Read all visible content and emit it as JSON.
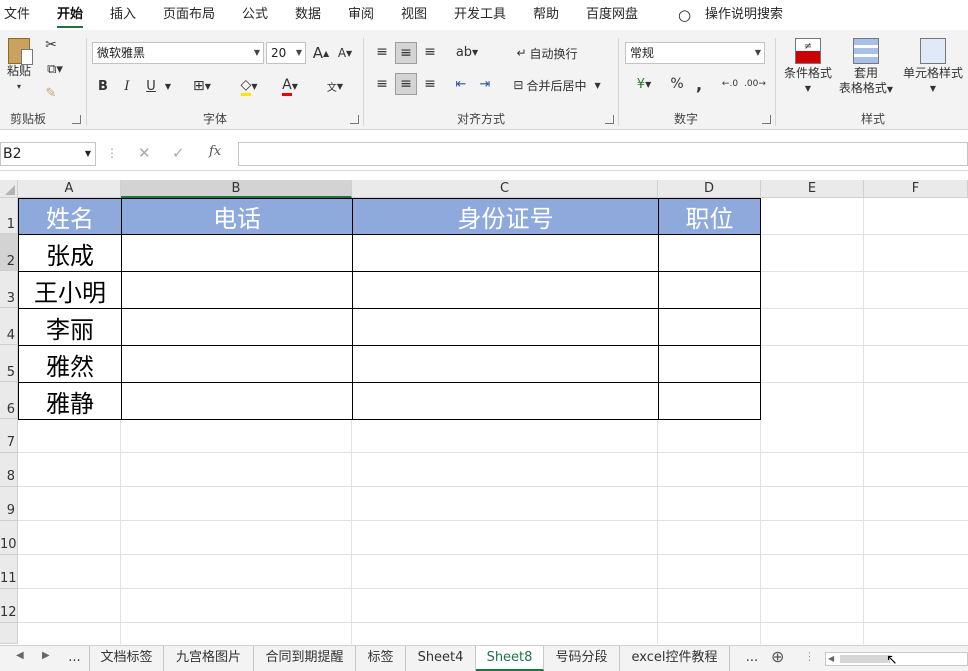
{
  "menu_tabs": [
    "文件",
    "开始",
    "插入",
    "页面布局",
    "公式",
    "数据",
    "审阅",
    "视图",
    "开发工具",
    "帮助",
    "百度网盘",
    "操作说明搜索"
  ],
  "clipboard": {
    "paste": "粘贴",
    "group": "剪贴板"
  },
  "font": {
    "name": "微软雅黑",
    "size": "20",
    "group": "字体",
    "bold": "B",
    "italic": "I",
    "underline": "U",
    "grow": "A",
    "shrink": "A",
    "color_a": "A"
  },
  "align": {
    "wrap": "自动换行",
    "merge": "合并后居中",
    "group": "对齐方式"
  },
  "number": {
    "format": "常规",
    "percent": "%",
    "comma": ",",
    "group": "数字"
  },
  "styles": {
    "cond": "条件格式",
    "table1": "套用",
    "table2": "表格格式",
    "cell": "单元格样式",
    "group": "样式"
  },
  "formula_bar": {
    "name_box": "B2",
    "cancel": "✕",
    "enter": "✓",
    "fx": "fx",
    "value": ""
  },
  "columns": [
    "A",
    "B",
    "C",
    "D",
    "E",
    "F"
  ],
  "rows": [
    "1",
    "2",
    "3",
    "4",
    "5",
    "6",
    "7",
    "8",
    "9",
    "10",
    "11",
    "12"
  ],
  "headers": [
    "姓名",
    "电话",
    "身份证号",
    "职位"
  ],
  "names": [
    "张成",
    "王小明",
    "李丽",
    "雅然",
    "雅静"
  ],
  "sheet_tabs": [
    "...",
    "文档标签",
    "九宫格图片",
    "合同到期提醒",
    "标签",
    "Sheet4",
    "Sheet8",
    "号码分段",
    "excel控件教程",
    "..."
  ],
  "active_sheet": "Sheet8"
}
